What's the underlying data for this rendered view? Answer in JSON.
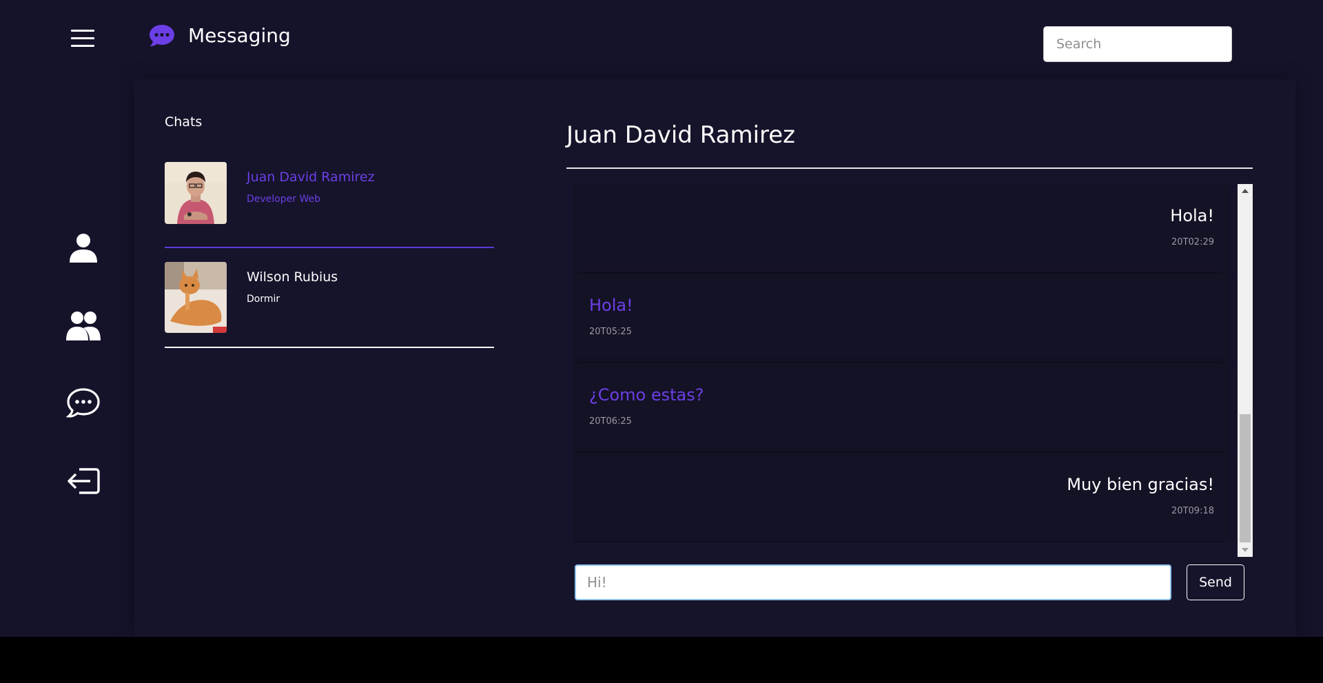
{
  "header": {
    "menu_icon": "hamburger-menu-icon",
    "brand_icon": "chat-bubble-icon",
    "title": "Messaging",
    "search_placeholder": "Search"
  },
  "sidebar": {
    "items": [
      {
        "icon": "user-icon"
      },
      {
        "icon": "users-group-icon"
      },
      {
        "icon": "chat-dots-icon"
      },
      {
        "icon": "logout-icon"
      }
    ]
  },
  "chats": {
    "heading": "Chats",
    "items": [
      {
        "name": "Juan David Ramirez",
        "status": "Developer Web",
        "active": true
      },
      {
        "name": "Wilson Rubius",
        "status": "Dormir",
        "active": false
      }
    ]
  },
  "conversation": {
    "title": "Juan David Ramirez",
    "messages": [
      {
        "text": "Hola!",
        "time": "20T02:29",
        "direction": "sent"
      },
      {
        "text": "Hola!",
        "time": "20T05:25",
        "direction": "received"
      },
      {
        "text": "¿Como estas?",
        "time": "20T06:25",
        "direction": "received"
      },
      {
        "text": "Muy bien gracias!",
        "time": "20T09:18",
        "direction": "sent"
      }
    ],
    "compose_placeholder": "Hi!",
    "send_label": "Send"
  },
  "colors": {
    "background": "#15132a",
    "accent": "#6c3fe6",
    "text": "#ffffff"
  }
}
